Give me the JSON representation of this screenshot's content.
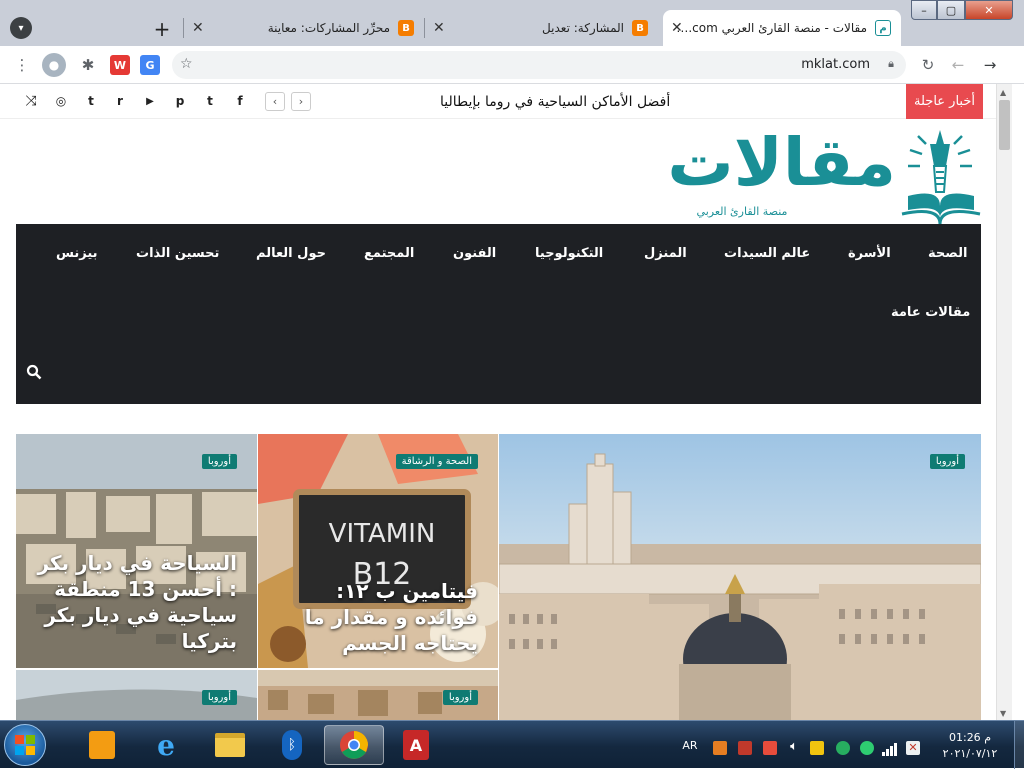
{
  "browser": {
    "tabs": [
      {
        "title": "مقالات - منصة القارئ العربي Mklat.com",
        "active": true
      },
      {
        "title": "المشاركة: تعديل",
        "active": false
      },
      {
        "title": "محرِّر المشاركات: معاينة",
        "active": false
      }
    ],
    "new_tab_label": "+",
    "address": "mklat.com",
    "window_controls": [
      "–",
      "▢",
      "✕"
    ]
  },
  "site": {
    "breaking": {
      "label": "أخبار عاجلة",
      "headline": "أفضل الأماكن السياحية في روما بإيطاليا"
    },
    "social_icons": [
      "facebook-icon",
      "twitter-icon",
      "pinterest-icon",
      "youtube-icon",
      "reddit-icon",
      "tumblr-icon",
      "instagram-icon",
      "shuffle-icon"
    ],
    "social_glyphs": {
      "facebook": "f",
      "twitter": "t",
      "pinterest": "p",
      "youtube": "▶",
      "reddit": "r",
      "tumblr": "t",
      "instagram": "◎",
      "shuffle": "⤨"
    },
    "logo": {
      "title": "مقالات",
      "tagline": "منصة القارئ العربي"
    },
    "nav": [
      "الصحة",
      "الأسرة",
      "عالم السيدات",
      "المنزل",
      "التكنولوجيا",
      "الفنون",
      "المجتمع",
      "حول العالم",
      "تحسين الذات",
      "بيزنس",
      "مقالات عامة"
    ],
    "cards": [
      {
        "tag": "أوروبا",
        "title": ""
      },
      {
        "tag": "الصحة و الرشاقة",
        "title": "فيتامين ب ١٢: فوائده و مقدار ما يحتاجه الجسم",
        "image_text": "VITAMIN",
        "image_text2": "B12"
      },
      {
        "tag": "أوروبا",
        "title": "السياحة في ديار بكر : أحسن 13 منطقة سياحية في ديار بكر بتركيا"
      },
      {
        "tag": "أوروبا",
        "title": ""
      },
      {
        "tag": "أوروبا",
        "title": ""
      }
    ]
  },
  "taskbar": {
    "lang": "AR",
    "time": "01:26 م",
    "date": "٢٠٢١/٠٧/١٢"
  },
  "colors": {
    "accent": "#0f7b73",
    "breaking": "#e84a4f",
    "nav": "#1e2024",
    "logo": "#1a8f96"
  }
}
